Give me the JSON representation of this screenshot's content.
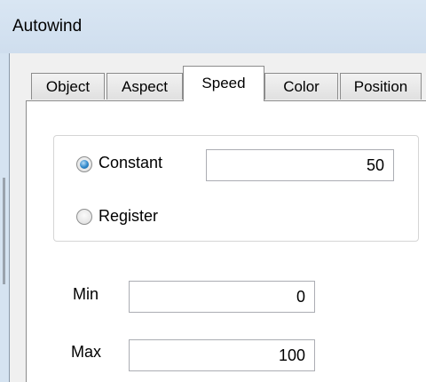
{
  "window": {
    "title": "Autowind"
  },
  "tabs": [
    {
      "label": "Object"
    },
    {
      "label": "Aspect"
    },
    {
      "label": "Speed"
    },
    {
      "label": "Color"
    },
    {
      "label": "Position"
    }
  ],
  "active_tab": "Speed",
  "speed_source": {
    "constant_label": "Constant",
    "register_label": "Register",
    "selected": "Constant",
    "constant_value": "50"
  },
  "limits": {
    "min_label": "Min",
    "min_value": "0",
    "max_label": "Max",
    "max_value": "100"
  }
}
